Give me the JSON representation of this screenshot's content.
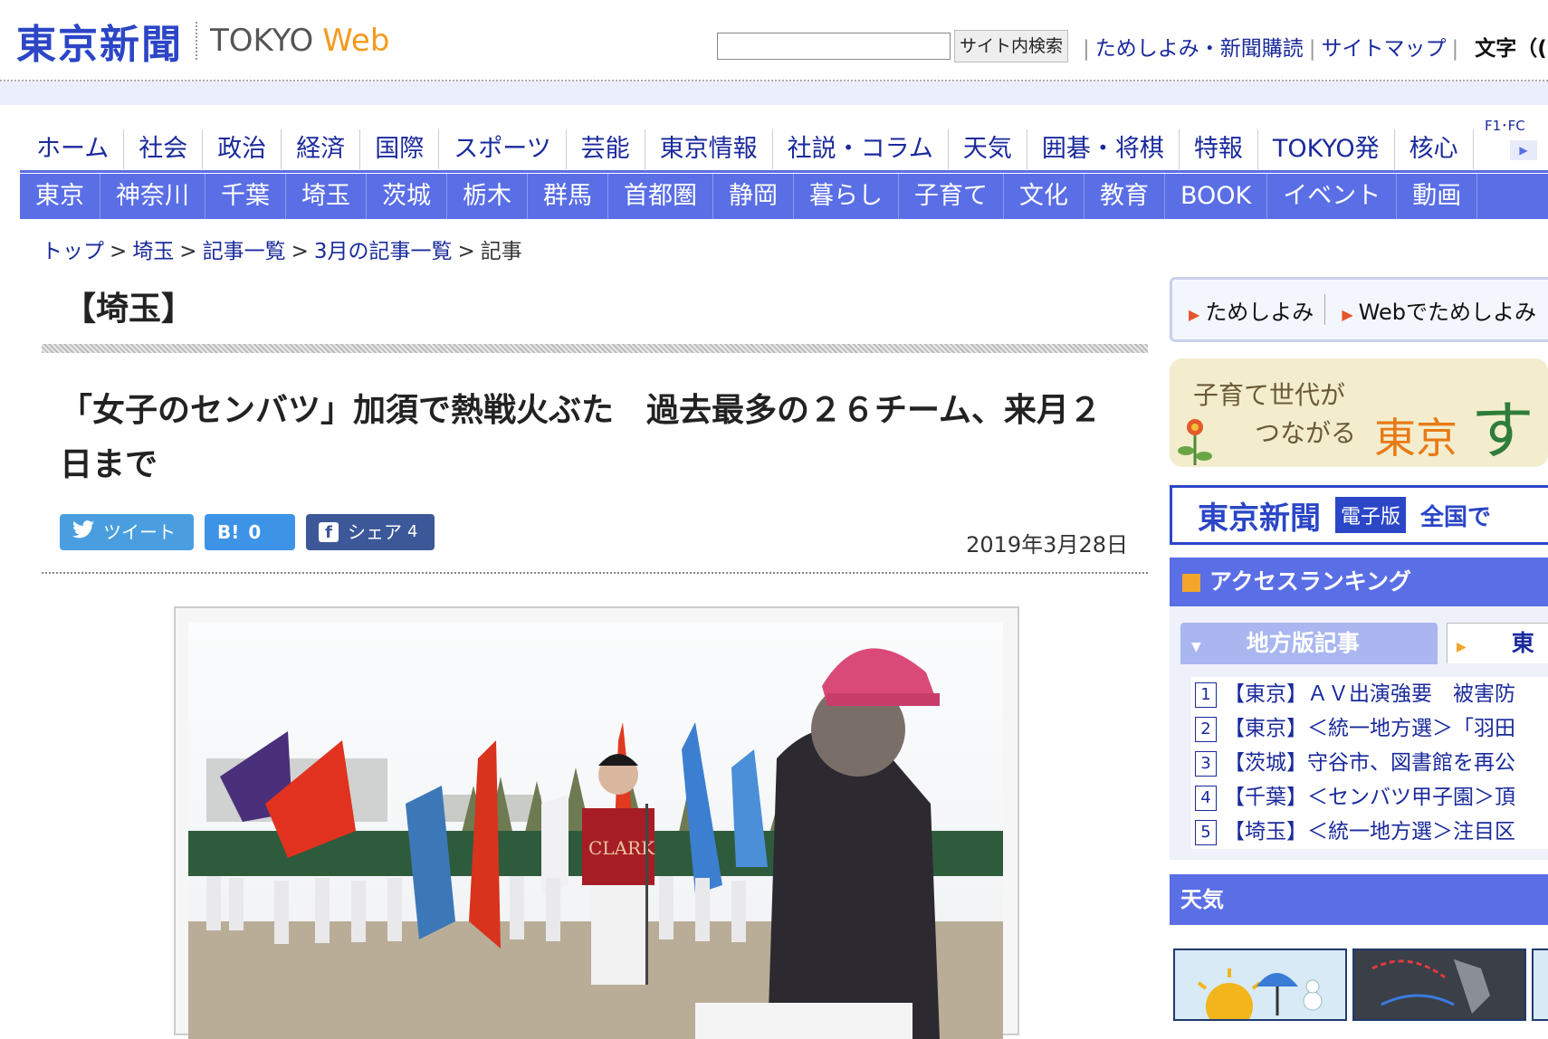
{
  "header": {
    "logo_jp": "東京新聞",
    "logo_en": "TOKYO",
    "logo_web": "Web",
    "search_placeholder": "",
    "search_button": "サイト内検索",
    "util_links": [
      "ためしよみ・新聞購読",
      "サイトマップ"
    ],
    "font_size_label": "文字（("
  },
  "global_nav": {
    "items": [
      "ホーム",
      "社会",
      "政治",
      "経済",
      "国際",
      "スポーツ",
      "芸能",
      "東京情報",
      "社説・コラム",
      "天気",
      "囲碁・将棋",
      "特報",
      "TOKYO発",
      "核心"
    ],
    "extra": "F1･FC"
  },
  "regional_nav": {
    "items": [
      "東京",
      "神奈川",
      "千葉",
      "埼玉",
      "茨城",
      "栃木",
      "群馬",
      "首都圏",
      "静岡",
      "暮らし",
      "子育て",
      "文化",
      "教育",
      "BOOK",
      "イベント",
      "動画"
    ]
  },
  "breadcrumb": {
    "items": [
      "トップ",
      "埼玉",
      "記事一覧",
      "3月の記事一覧"
    ],
    "current": "記事",
    "separator": ">"
  },
  "article": {
    "section": "【埼玉】",
    "headline": "「女子のセンバツ」加須で熱戦火ぶた　過去最多の２６チーム、来月２日まで",
    "date": "2019年3月28日",
    "social": {
      "tweet_label": "ツイート",
      "hatena_icon": "B!",
      "hatena_count": "0",
      "share_label": "シェア",
      "share_count": "4"
    },
    "photo_jersey_text": "CLARK"
  },
  "sidebar": {
    "trial_links": [
      "ためしよみ",
      "Webでためしよみ"
    ],
    "kosodate_banner": {
      "line1": "子育て世代が",
      "line2": "つながる",
      "tokyo": "東京",
      "tail": "す"
    },
    "ebook_banner": {
      "logo": "東京新聞",
      "tag": "電子版",
      "text": "全国で"
    },
    "ranking": {
      "title": "アクセスランキング",
      "tab_active": "地方版記事",
      "tab_other": "東",
      "items": [
        {
          "num": "1",
          "text": "【東京】ＡＶ出演強要　被害防"
        },
        {
          "num": "2",
          "text": "【東京】＜統一地方選＞「羽田"
        },
        {
          "num": "3",
          "text": "【茨城】守谷市、図書館を再公"
        },
        {
          "num": "4",
          "text": "【千葉】＜センバツ甲子園＞頂"
        },
        {
          "num": "5",
          "text": "【埼玉】＜統一地方選＞注目区"
        }
      ]
    },
    "weather_title": "天気"
  },
  "colors": {
    "brand_blue": "#2b46c7",
    "nav_blue": "#5a6ee6",
    "link": "#1a2a9c",
    "accent_orange": "#f39a1e"
  }
}
